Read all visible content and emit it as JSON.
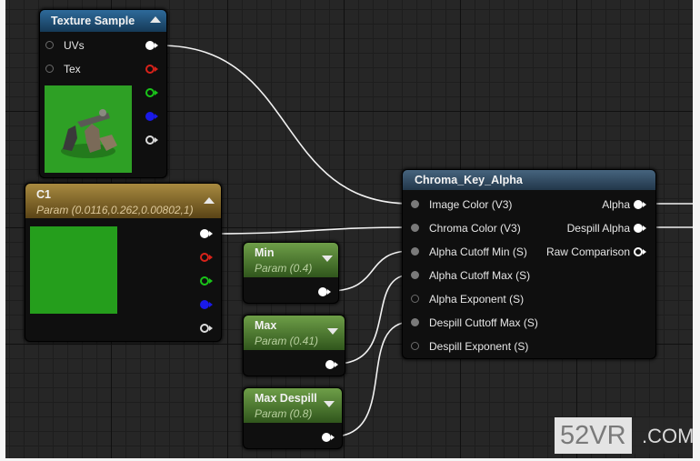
{
  "watermark": {
    "main": "52VR",
    "suffix": ".COM"
  },
  "texture_sample": {
    "title": "Texture Sample",
    "inputs": [
      {
        "label": "UVs"
      },
      {
        "label": "Tex"
      }
    ],
    "output_pins": [
      {
        "color": "#ffffff",
        "filled": true
      },
      {
        "color": "#d8221a",
        "filled": false
      },
      {
        "color": "#19c419",
        "filled": false
      },
      {
        "color": "#1a1ae8",
        "filled": true
      },
      {
        "color": "#dcdcdc",
        "filled": false
      }
    ],
    "header_color": "#1e4f78",
    "preview_color": "#2ea025"
  },
  "c1": {
    "title": "C1",
    "param": "Param (0.0116,0.262,0.00802,1)",
    "swatch_color": "#259e1c",
    "header_color": "#8a6a20",
    "output_pins": [
      {
        "color": "#ffffff",
        "filled": true
      },
      {
        "color": "#d8221a",
        "filled": false
      },
      {
        "color": "#19c419",
        "filled": false
      },
      {
        "color": "#1a1ae8",
        "filled": true
      },
      {
        "color": "#dcdcdc",
        "filled": false
      }
    ]
  },
  "scalar_params": [
    {
      "name": "Min",
      "param": "Param (0.4)"
    },
    {
      "name": "Max",
      "param": "Param (0.41)"
    },
    {
      "name": "Max Despill",
      "param": "Param (0.8)"
    }
  ],
  "chroma": {
    "title": "Chroma_Key_Alpha",
    "header_color": "#34506a",
    "inputs": [
      {
        "label": "Image Color (V3)",
        "connected": true
      },
      {
        "label": "Chroma Color (V3)",
        "connected": true
      },
      {
        "label": "Alpha Cutoff Min (S)",
        "connected": true
      },
      {
        "label": "Alpha Cutoff Max (S)",
        "connected": true
      },
      {
        "label": "Alpha Exponent (S)",
        "connected": false
      },
      {
        "label": "Despill Cuttoff Max (S)",
        "connected": true
      },
      {
        "label": "Despill Exponent (S)",
        "connected": false
      }
    ],
    "outputs": [
      {
        "label": "Alpha",
        "filled": true
      },
      {
        "label": "Despill Alpha",
        "filled": true
      },
      {
        "label": "Raw Comparison",
        "filled": false
      }
    ]
  }
}
